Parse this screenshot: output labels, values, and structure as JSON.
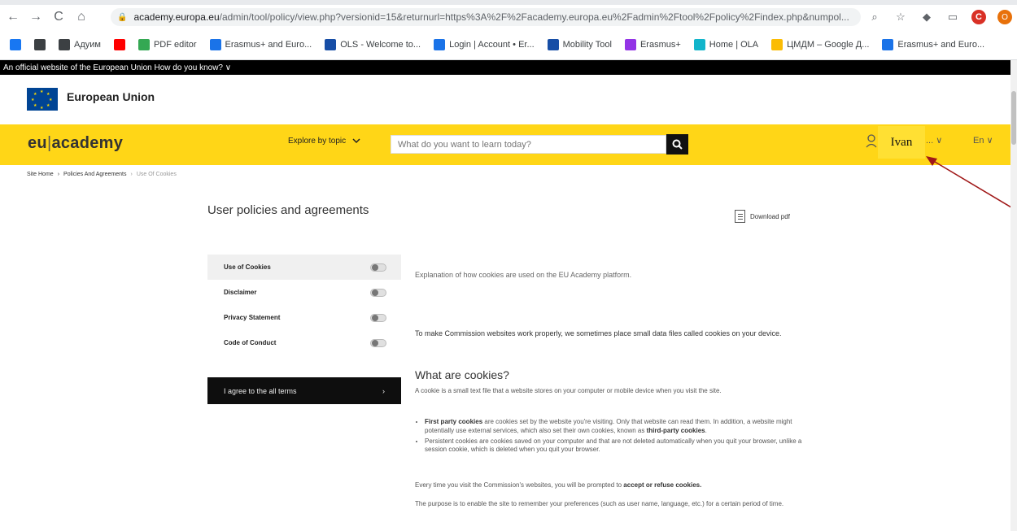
{
  "browser": {
    "url_domain": "academy.europa.eu",
    "url_path": "/admin/tool/policy/view.php?versionid=15&returnurl=https%3A%2F%2Facademy.europa.eu%2Fadmin%2Ftool%2Fpolicy%2Findex.php&numpol...",
    "bookmarks": [
      {
        "label": "",
        "color": "#1877f2"
      },
      {
        "label": "",
        "color": "#3c4043"
      },
      {
        "label": "Адуим",
        "color": "#3c4043"
      },
      {
        "label": "",
        "color": "#ff0000"
      },
      {
        "label": "PDF editor",
        "color": "#34a853"
      },
      {
        "label": "Erasmus+ and Euro...",
        "color": "#1a73e8"
      },
      {
        "label": "OLS - Welcome to...",
        "color": "#174ea6"
      },
      {
        "label": "Login | Account • Er...",
        "color": "#1a73e8"
      },
      {
        "label": "Mobility Tool",
        "color": "#174ea6"
      },
      {
        "label": "Erasmus+",
        "color": "#9334e6"
      },
      {
        "label": "Home | OLA",
        "color": "#12b5cb"
      },
      {
        "label": "ЦМДМ – Google Д...",
        "color": "#fbbc04"
      },
      {
        "label": "Erasmus+ and Euro...",
        "color": "#1a73e8"
      }
    ]
  },
  "eu": {
    "official_bar": "An official website of the European Union   How do you know? ∨",
    "name": "European Union"
  },
  "header": {
    "logo_left": "eu",
    "logo_sep": "|",
    "logo_right": "academy",
    "explore_label": "Explore by topic",
    "search_placeholder": "What do you want to learn today?",
    "user_name": "Ivan",
    "user_more": "... ∨",
    "language": "En ∨"
  },
  "breadcrumb": {
    "home": "Site Home",
    "sep": "›",
    "section": "Policies And Agreements",
    "current": "Use Of Cookies"
  },
  "main": {
    "title": "User policies and agreements",
    "download_label": "Download pdf",
    "policies": [
      {
        "label": "Use of Cookies"
      },
      {
        "label": "Disclaimer"
      },
      {
        "label": "Privacy Statement"
      },
      {
        "label": "Code of Conduct"
      }
    ],
    "agree_label": "I agree to the all terms",
    "agree_arrow": "›",
    "explanation": "Explanation of how cookies are used on the EU Academy platform.",
    "make_work": "To make Commission websites work properly, we sometimes place small data files called cookies on your device.",
    "what_heading": "What are cookies?",
    "definition": "A cookie is a small text file that a website stores on your computer or mobile device when you visit the site.",
    "bullet1_bold": "First party cookies",
    "bullet1_text": " are cookies set by the website you're visiting. Only that website can read them. In addition, a website might potentially use external services, which also set their own cookies, known as ",
    "bullet1_bold2": "third-party cookies",
    "bullet1_end": ".",
    "bullet2": "Persistent cookies are cookies saved on your computer and that are not deleted automatically when you quit your browser, unlike a session cookie, which is deleted when you quit your browser.",
    "every_time": "Every time you visit the Commission's websites, you will be prompted to ",
    "every_time_bold": "accept or refuse cookies.",
    "purpose": "The purpose is to enable the site to remember your preferences (such as user name, language, etc.) for a certain period of time."
  }
}
